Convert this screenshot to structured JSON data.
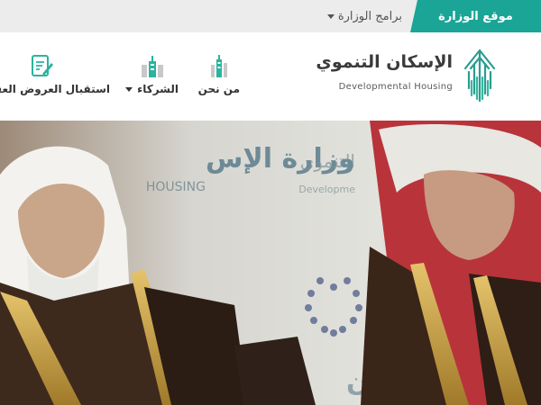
{
  "topbar": {
    "ministry_site": "موقع الوزارة",
    "ministry_programs": "برامج الوزارة"
  },
  "logo": {
    "name_ar": "الإسكان التنموي",
    "name_en": "Developmental Housing"
  },
  "nav": {
    "about": "من نحن",
    "partners": "الشركاء",
    "offers": "استقبال العروض العقارية"
  },
  "hero": {
    "backdrop_text_1": "وزارة الإس",
    "backdrop_text_2": "HOUSING",
    "backdrop_text_3": "التنموي",
    "backdrop_text_4": "Developme",
    "backdrop_text_5": "لإسكان"
  },
  "colors": {
    "accent": "#1aa596",
    "topbar_bg": "#ececec"
  }
}
